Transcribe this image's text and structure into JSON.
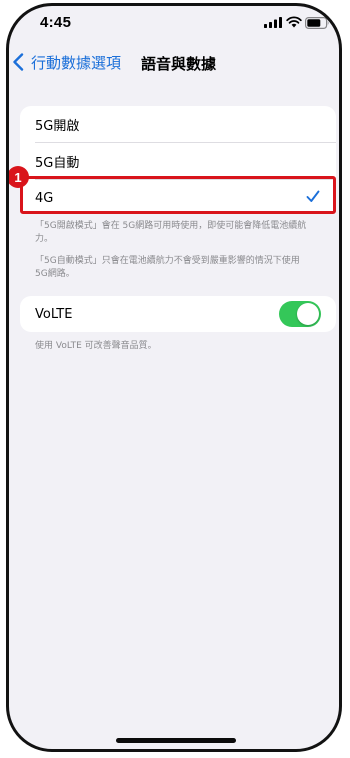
{
  "status_bar": {
    "time": "4:45",
    "icons": [
      "signal-icon",
      "wifi-icon",
      "battery-icon"
    ]
  },
  "nav": {
    "back_label": "行動數據選項",
    "title": "語音與數據"
  },
  "network_options": [
    {
      "label": "5G開啟",
      "selected": false
    },
    {
      "label": "5G自動",
      "selected": false
    },
    {
      "label": "4G",
      "selected": true
    }
  ],
  "annotation": {
    "step_number": "1",
    "color": "#d9141b"
  },
  "footnotes": {
    "five_g_on": "「5G開啟模式」會在 5G網路可用時使用，即使可能會降低電池續航力。",
    "five_g_auto": "「5G自動模式」只會在電池續航力不會受到嚴重影響的情況下使用 5G網路。"
  },
  "volte": {
    "label": "VoLTE",
    "enabled": true,
    "footnote": "使用 VoLTE 可改善聲音品質。"
  },
  "colors": {
    "accent": "#1b6fd9",
    "toggle_on": "#34c759",
    "background": "#f2f1f6",
    "annotation_red": "#d9141b"
  }
}
